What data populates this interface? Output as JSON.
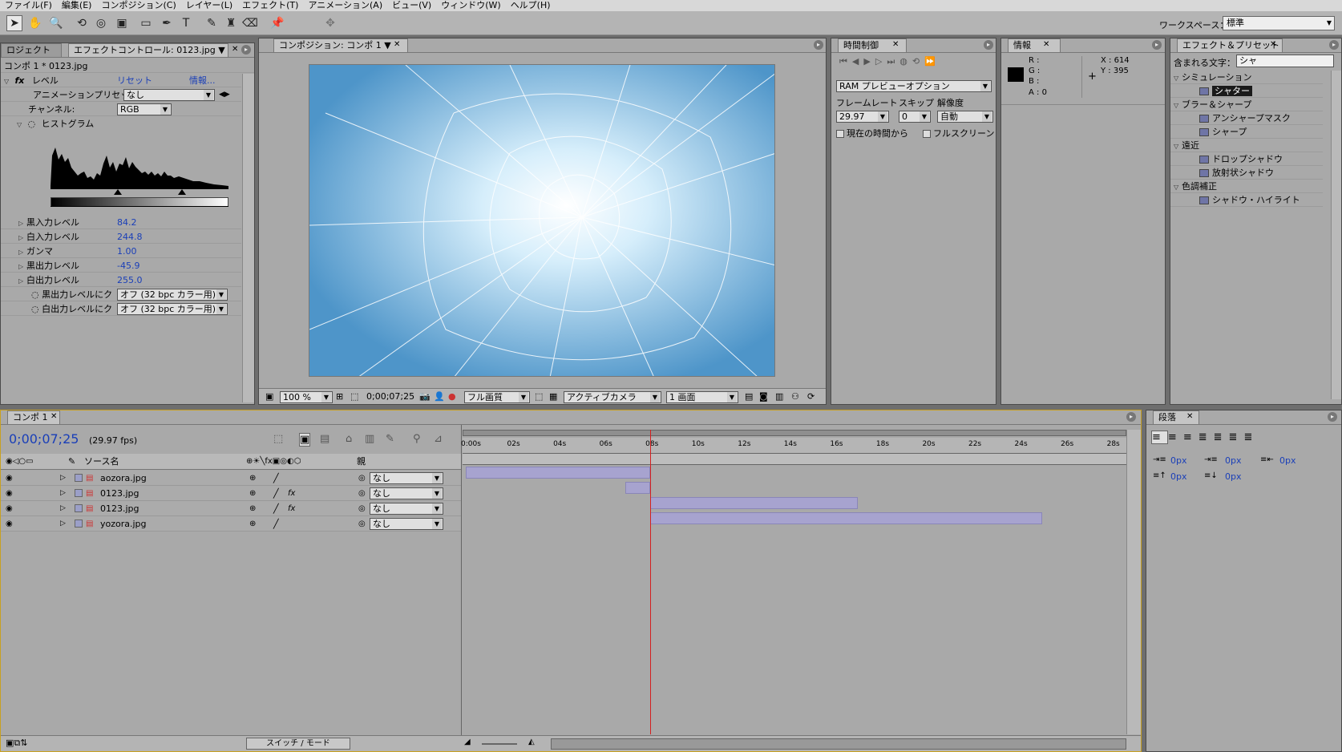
{
  "menu": [
    "ファイル(F)",
    "編集(E)",
    "コンポジション(C)",
    "レイヤー(L)",
    "エフェクト(T)",
    "アニメーション(A)",
    "ビュー(V)",
    "ウィンドウ(W)",
    "ヘルプ(H)"
  ],
  "workspace": {
    "label": "ワークスペース：",
    "value": "標準"
  },
  "project_tab": "ロジェクト",
  "effect_controls": {
    "tab": "エフェクトコントロール: 0123.jpg",
    "subtitle": "コンポ 1 * 0123.jpg",
    "effect_name": "レベル",
    "reset": "リセット",
    "info": "情報...",
    "preset_label": "アニメーションプリセット",
    "preset_value": "なし",
    "channel_label": "チャンネル:",
    "channel_value": "RGB",
    "histogram_label": "ヒストグラム",
    "params": [
      {
        "label": "黒入力レベル",
        "value": "84.2"
      },
      {
        "label": "白入力レベル",
        "value": "244.8"
      },
      {
        "label": "ガンマ",
        "value": "1.00"
      },
      {
        "label": "黒出力レベル",
        "value": "-45.9"
      },
      {
        "label": "白出力レベル",
        "value": "255.0"
      }
    ],
    "clip": [
      {
        "label": "黒出力レベルにク",
        "value": "オフ (32 bpc カラー用)"
      },
      {
        "label": "白出力レベルにク",
        "value": "オフ (32 bpc カラー用)"
      }
    ]
  },
  "composition": {
    "tab": "コンポジション: コンポ 1",
    "zoom": "100 %",
    "timecode": "0;00;07;25",
    "quality": "フル画質",
    "camera": "アクティブカメラ",
    "views": "1 画面"
  },
  "time_control": {
    "tab": "時間制御",
    "ram_preview": "RAM プレビューオプション",
    "framerate_label": "フレームレート",
    "skip_label": "スキップ",
    "resolution_label": "解像度",
    "framerate": "29.97",
    "skip": "0",
    "resolution": "自動",
    "from_current": "現在の時間から",
    "fullscreen": "フルスクリーン"
  },
  "info": {
    "tab": "情報",
    "r": "R :",
    "g": "G :",
    "b": "B :",
    "a": "A : 0",
    "x": "X : 614",
    "y": "Y : 395"
  },
  "effects_presets": {
    "tab": "エフェクト＆プリセット",
    "search_label": "含まれる文字：",
    "search_value": "シャ",
    "groups": [
      {
        "name": "シミュレーション",
        "items": [
          "シャター"
        ]
      },
      {
        "name": "ブラー＆シャープ",
        "items": [
          "アンシャープマスク",
          "シャープ"
        ]
      },
      {
        "name": "遠近",
        "items": [
          "ドロップシャドウ",
          "放射状シャドウ"
        ]
      },
      {
        "name": "色調補正",
        "items": [
          "シャドウ・ハイライト"
        ]
      }
    ]
  },
  "timeline": {
    "tab": "コンポ 1",
    "timecode": "0;00;07;25",
    "fps": "(29.97 fps)",
    "source_header": "ソース名",
    "parent_header": "親",
    "ruler": [
      "0:00s",
      "02s",
      "04s",
      "06s",
      "08s",
      "10s",
      "12s",
      "14s",
      "16s",
      "18s",
      "20s",
      "22s",
      "24s",
      "26s",
      "28s"
    ],
    "layers": [
      {
        "name": "aozora.jpg",
        "parent": "なし",
        "fx": "",
        "start": 0,
        "end": 8
      },
      {
        "name": "0123.jpg",
        "parent": "なし",
        "fx": "fx",
        "start": 6.9,
        "end": 8.0
      },
      {
        "name": "0123.jpg",
        "parent": "なし",
        "fx": "fx",
        "start": 8.0,
        "end": 17.0
      },
      {
        "name": "yozora.jpg",
        "parent": "なし",
        "fx": "",
        "start": 8.0,
        "end": 25.0
      }
    ],
    "current_time": 8,
    "duration": 28.5,
    "switch_mode": "スイッチ / モード"
  },
  "paragraph": {
    "tab": "段落",
    "values": [
      "0px",
      "0px",
      "0px",
      "0px",
      "0px"
    ]
  }
}
